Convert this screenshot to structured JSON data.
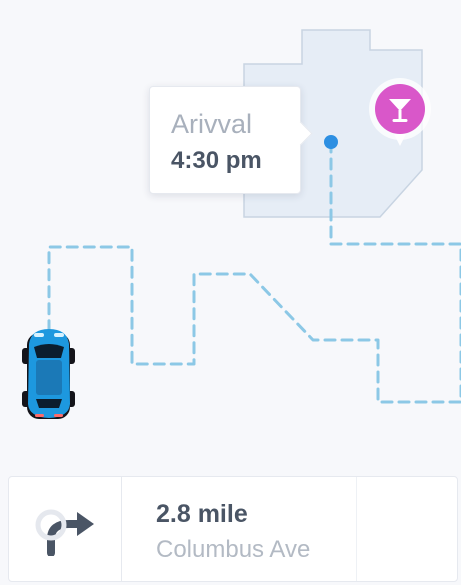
{
  "arrival": {
    "label": "Arivval",
    "time": "4:30 pm"
  },
  "navigation": {
    "distance": "2.8 mile",
    "street": "Columbus Ave"
  },
  "icons": {
    "destination": "cocktail-glass-icon",
    "vehicle": "car-icon",
    "maneuver": "turn-right-icon"
  },
  "colors": {
    "background": "#f7f8fb",
    "destination_area": "#e6edf6",
    "route": "#8cc8e6",
    "location_dot": "#2d8fe2",
    "destination_marker": "#d957c9",
    "car_body": "#1d98df",
    "text_primary": "#4a5565",
    "text_secondary": "#a8b0bc"
  }
}
